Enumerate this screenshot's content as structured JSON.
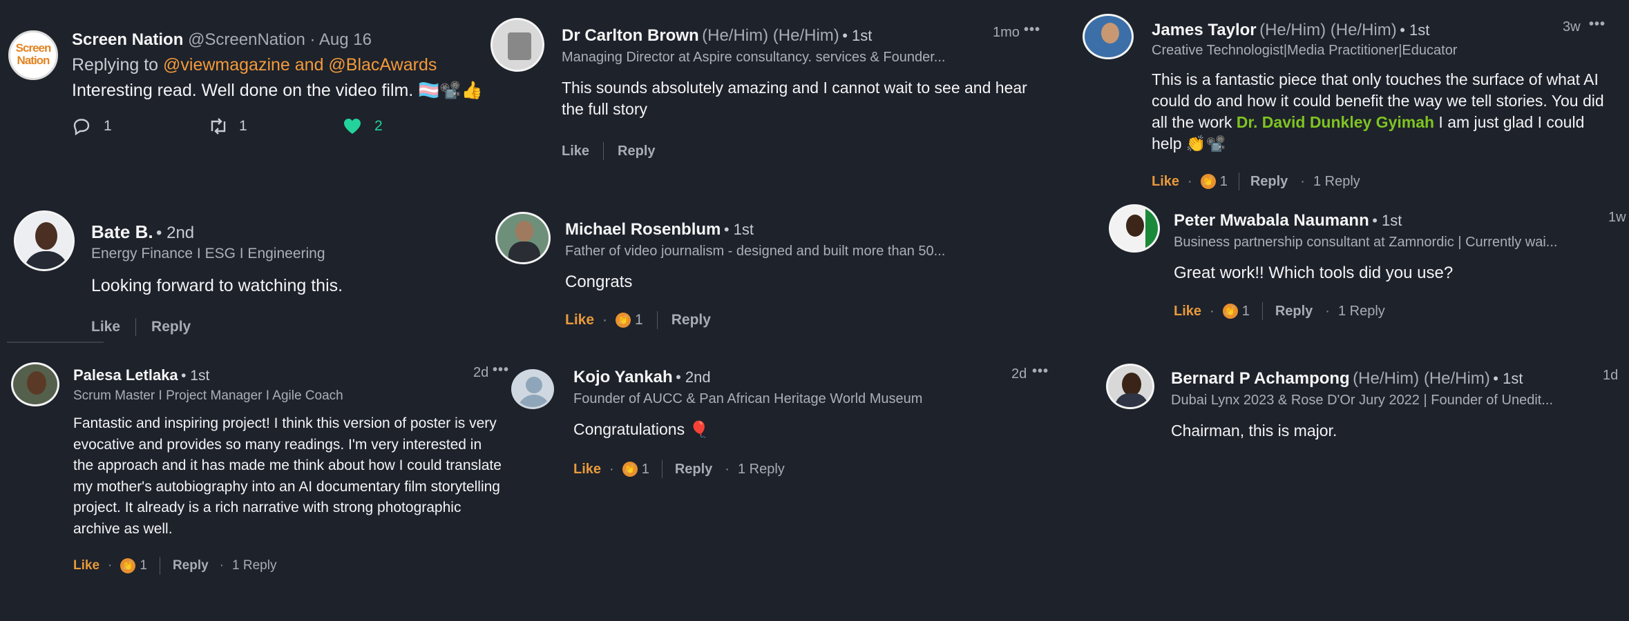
{
  "tweet": {
    "name": "Screen Nation",
    "handle": "@ScreenNation",
    "date": "· Aug 16",
    "avatar_text": "Screen Nation",
    "replying_prefix": "Replying to ",
    "replying_to": "@viewmagazine and @BlacAwards",
    "text": "Interesting read. Well done on the video film. 🏳️‍⚧️📽️👍",
    "reply_count": "1",
    "retweet_count": "1",
    "like_count": "2",
    "like_color": "#23d39b"
  },
  "comments": [
    {
      "name": "Dr Carlton Brown",
      "pronouns": "(He/Him)  (He/Him)",
      "degree": "• 1st",
      "headline": "Managing Director at Aspire consultancy. services & Founder...",
      "time": "1mo",
      "text": "This sounds absolutely amazing and I cannot wait to see and hear the full story",
      "like": "Like",
      "reply": "Reply"
    },
    {
      "name": "James Taylor",
      "pronouns": "(He/Him)  (He/Him)",
      "degree": "• 1st",
      "headline": "Creative Technologist|Media Practitioner|Educator",
      "time": "3w",
      "text_before": "This is a fantastic piece that only touches the surface of what AI could do and how it could benefit the way we tell stories. You did all the work ",
      "mention": "Dr. David Dunkley Gyimah",
      "text_after": " I am just glad I could help 👏📽️",
      "like": "Like",
      "reaction_count": "1",
      "reply": "Reply",
      "replies": "1 Reply"
    },
    {
      "name": "Bate B.",
      "degree": "• 2nd",
      "headline": "Energy Finance I ESG I Engineering",
      "text": "Looking forward to watching this.",
      "like": "Like",
      "reply": "Reply"
    },
    {
      "name": "Michael Rosenblum",
      "degree": "• 1st",
      "headline": "Father of video journalism - designed and built more than 50...",
      "text": "Congrats",
      "like": "Like",
      "reaction_count": "1",
      "reply": "Reply"
    },
    {
      "name": "Peter Mwabala Naumann",
      "degree": "• 1st",
      "headline": "Business partnership consultant at Zamnordic | Currently wai...",
      "time": "1w",
      "text": "Great work!! Which tools did you use?",
      "like": "Like",
      "reaction_count": "1",
      "reply": "Reply",
      "replies": "1 Reply"
    },
    {
      "name": "Palesa Letlaka",
      "degree": "• 1st",
      "headline": "Scrum Master I Project Manager I Agile Coach",
      "time": "2d",
      "text": "Fantastic and inspiring project! I think this version of poster is very evocative and provides so many readings. I'm very interested in the approach and it has made me think about how I could translate my mother's autobiography into an AI documentary film storytelling project. It already is a rich narrative with strong photographic archive as well.",
      "like": "Like",
      "reaction_count": "1",
      "reply": "Reply",
      "replies": "1 Reply"
    },
    {
      "name": "Kojo Yankah",
      "degree": "• 2nd",
      "headline": "Founder of AUCC & Pan African Heritage World Museum",
      "time": "2d",
      "text": "Congratulations 🎈",
      "like": "Like",
      "reaction_count": "1",
      "reply": "Reply",
      "replies": "1 Reply"
    },
    {
      "name": "Bernard P Achampong",
      "pronouns": "(He/Him)  (He/Him)",
      "degree": "• 1st",
      "headline": "Dubai Lynx 2023 & Rose D'Or Jury 2022 | Founder of Unedit...",
      "time": "1d",
      "text": "Chairman, this is major."
    }
  ],
  "colors": {
    "background": "#1e222b",
    "like_active": "#e99a3a",
    "mention_orange": "#f39a3a",
    "mention_green": "#7ec421"
  }
}
